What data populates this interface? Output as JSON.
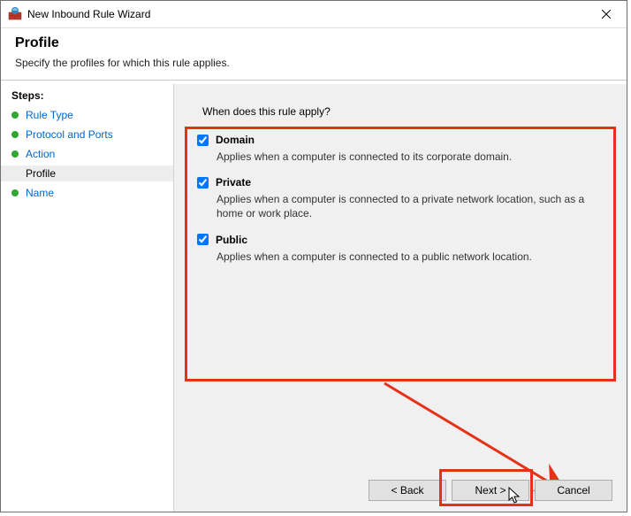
{
  "window": {
    "title": "New Inbound Rule Wizard"
  },
  "header": {
    "title": "Profile",
    "subtitle": "Specify the profiles for which this rule applies."
  },
  "sidebar": {
    "heading": "Steps:",
    "items": [
      {
        "label": "Rule Type",
        "state": "done",
        "link": true
      },
      {
        "label": "Protocol and Ports",
        "state": "done",
        "link": true
      },
      {
        "label": "Action",
        "state": "done",
        "link": true
      },
      {
        "label": "Profile",
        "state": "current",
        "link": false
      },
      {
        "label": "Name",
        "state": "future",
        "link": true
      }
    ]
  },
  "content": {
    "question": "When does this rule apply?",
    "options": [
      {
        "key": "domain",
        "label": "Domain",
        "checked": true,
        "desc": "Applies when a computer is connected to its corporate domain."
      },
      {
        "key": "private",
        "label": "Private",
        "checked": true,
        "desc": "Applies when a computer is connected to a private network location, such as a home or work place."
      },
      {
        "key": "public",
        "label": "Public",
        "checked": true,
        "desc": "Applies when a computer is connected to a public network location."
      }
    ]
  },
  "buttons": {
    "back": "< Back",
    "next": "Next >",
    "cancel": "Cancel"
  }
}
